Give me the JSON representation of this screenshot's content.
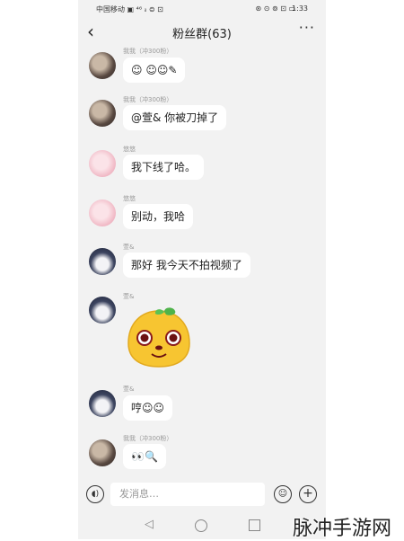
{
  "status": {
    "carrier": "中国移动 ▣ ⁴⁶ ᵢₗ ⊜ ⊡",
    "icons": "⊛ ⊙ ⊚ ⊡ ▭",
    "time": "1:33"
  },
  "header": {
    "back": "‹",
    "title": "粉丝群(63)",
    "more": "···"
  },
  "messages": [
    {
      "sender": "我我（冲300粉）",
      "text": "☺                ☺☺✎"
    },
    {
      "sender": "我我（冲300粉）",
      "text": "@萱& 你被刀掉了"
    },
    {
      "sender": "悠悠",
      "text": "我下线了哈。"
    },
    {
      "sender": "悠悠",
      "text": "别动，我哈"
    },
    {
      "sender": "萱&",
      "text": "那好 我今天不拍视频了"
    },
    {
      "sender": "萱&",
      "text": ""
    },
    {
      "sender": "萱&",
      "text": "哼☺☺"
    },
    {
      "sender": "我我（冲300粉）",
      "text": "👀🔍"
    }
  ],
  "input": {
    "placeholder": "发消息…",
    "voice_icon": "voice-icon",
    "emoji_icon": "emoji-icon",
    "plus_icon": "plus-icon"
  },
  "sysnav": {
    "back": "◁",
    "home": "○",
    "recent": "□"
  },
  "watermark": "脉冲手游网"
}
